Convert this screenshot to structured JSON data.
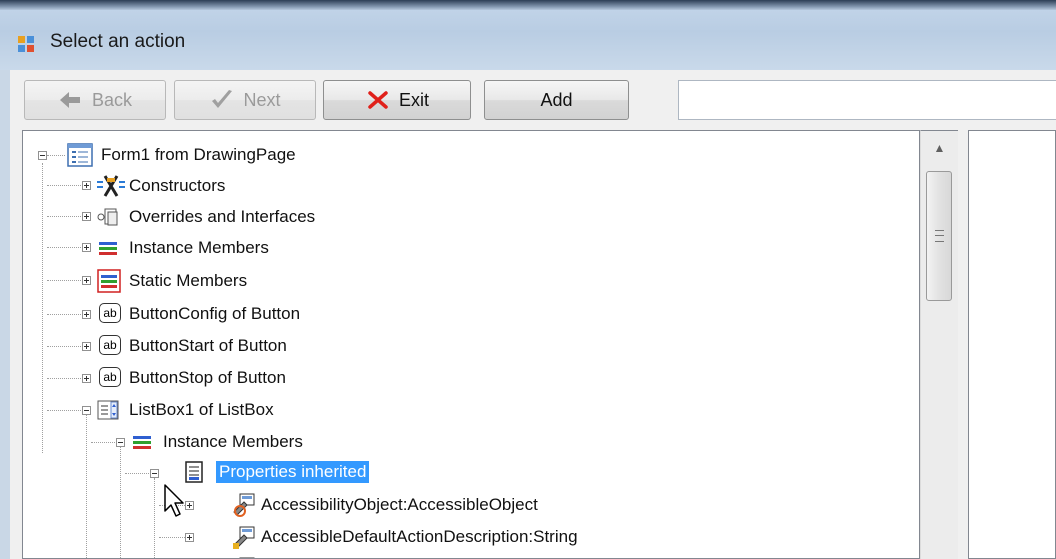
{
  "window": {
    "title": "Select an action"
  },
  "toolbar": {
    "back_label": "Back",
    "next_label": "Next",
    "exit_label": "Exit",
    "add_label": "Add",
    "address_value": ""
  },
  "tree": {
    "items": [
      {
        "label": "Form1 from DrawingPage",
        "icon": "form-icon",
        "expanded": true
      },
      {
        "label": "Constructors",
        "icon": "constructors-icon",
        "expanded": false
      },
      {
        "label": "Overrides and Interfaces",
        "icon": "overrides-icon",
        "expanded": false
      },
      {
        "label": "Instance Members",
        "icon": "instance-members-icon",
        "expanded": false
      },
      {
        "label": "Static Members",
        "icon": "static-members-icon",
        "expanded": false
      },
      {
        "label": "ButtonConfig of Button",
        "icon": "button-ab-icon",
        "expanded": false
      },
      {
        "label": "ButtonStart of Button",
        "icon": "button-ab-icon",
        "expanded": false
      },
      {
        "label": "ButtonStop of Button",
        "icon": "button-ab-icon",
        "expanded": false
      },
      {
        "label": "ListBox1 of ListBox",
        "icon": "listbox-icon",
        "expanded": true
      },
      {
        "label": "Instance Members",
        "icon": "instance-members-icon",
        "expanded": true
      },
      {
        "label": "Properties inherited",
        "icon": "properties-icon",
        "expanded": true,
        "selected": true
      },
      {
        "label": "AccessibilityObject:AccessibleObject",
        "icon": "property-icon",
        "expanded": false
      },
      {
        "label": "AccessibleDefaultActionDescription:String",
        "icon": "property-icon",
        "expanded": false
      }
    ]
  }
}
